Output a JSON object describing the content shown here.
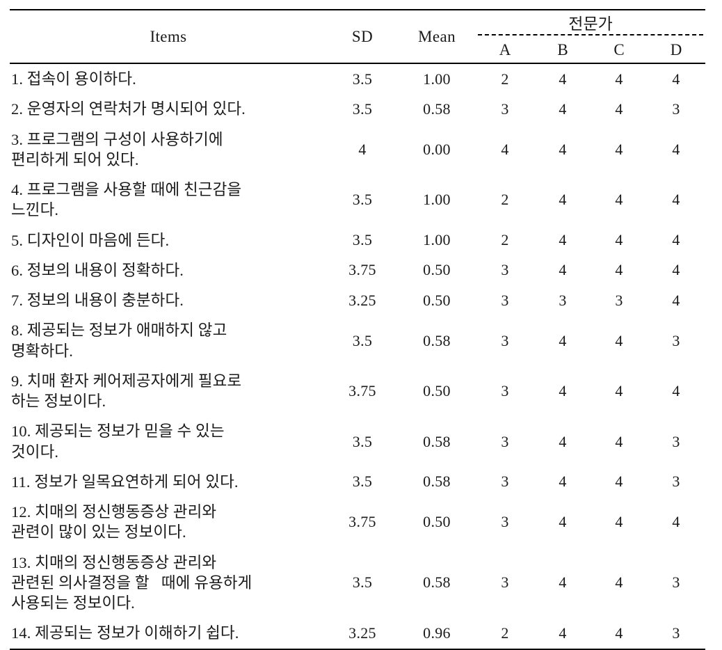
{
  "table": {
    "headers": {
      "items": "Items",
      "sd": "SD",
      "mean": "Mean",
      "group": "전문가",
      "a": "A",
      "b": "B",
      "c": "C",
      "d": "D"
    },
    "rows": [
      {
        "item": "1. 접속이 용이하다.",
        "sd": "3.5",
        "mean": "1.00",
        "a": "2",
        "b": "4",
        "c": "4",
        "d": "4"
      },
      {
        "item": "2. 운영자의 연락처가 명시되어 있다.",
        "sd": "3.5",
        "mean": "0.58",
        "a": "3",
        "b": "4",
        "c": "4",
        "d": "3"
      },
      {
        "item": "3. 프로그램의 구성이 사용하기에\n편리하게 되어 있다.",
        "sd": "4",
        "mean": "0.00",
        "a": "4",
        "b": "4",
        "c": "4",
        "d": "4"
      },
      {
        "item": "4. 프로그램을 사용할 때에 친근감을\n느낀다.",
        "sd": "3.5",
        "mean": "1.00",
        "a": "2",
        "b": "4",
        "c": "4",
        "d": "4"
      },
      {
        "item": "5. 디자인이 마음에 든다.",
        "sd": "3.5",
        "mean": "1.00",
        "a": "2",
        "b": "4",
        "c": "4",
        "d": "4"
      },
      {
        "item": "6. 정보의 내용이 정확하다.",
        "sd": "3.75",
        "mean": "0.50",
        "a": "3",
        "b": "4",
        "c": "4",
        "d": "4"
      },
      {
        "item": "7. 정보의 내용이 충분하다.",
        "sd": "3.25",
        "mean": "0.50",
        "a": "3",
        "b": "3",
        "c": "3",
        "d": "4"
      },
      {
        "item": "8. 제공되는 정보가 애매하지 않고\n명확하다.",
        "sd": "3.5",
        "mean": "0.58",
        "a": "3",
        "b": "4",
        "c": "4",
        "d": "3"
      },
      {
        "item": "9. 치매 환자 케어제공자에게 필요로\n하는 정보이다.",
        "sd": "3.75",
        "mean": "0.50",
        "a": "3",
        "b": "4",
        "c": "4",
        "d": "4"
      },
      {
        "item": "10. 제공되는 정보가 믿을 수 있는\n것이다.",
        "sd": "3.5",
        "mean": "0.58",
        "a": "3",
        "b": "4",
        "c": "4",
        "d": "3"
      },
      {
        "item": "11. 정보가 일목요연하게 되어 있다.",
        "sd": "3.5",
        "mean": "0.58",
        "a": "3",
        "b": "4",
        "c": "4",
        "d": "3"
      },
      {
        "item": "12. 치매의 정신행동증상 관리와\n관련이 많이 있는 정보이다.",
        "sd": "3.75",
        "mean": "0.50",
        "a": "3",
        "b": "4",
        "c": "4",
        "d": "4"
      },
      {
        "item": "13. 치매의 정신행동증상 관리와\n관련된 의사결정을 할   때에 유용하게\n사용되는 정보이다.",
        "sd": "3.5",
        "mean": "0.58",
        "a": "3",
        "b": "4",
        "c": "4",
        "d": "3"
      },
      {
        "item": "14. 제공되는 정보가 이해하기 쉽다.",
        "sd": "3.25",
        "mean": "0.96",
        "a": "2",
        "b": "4",
        "c": "4",
        "d": "3"
      }
    ]
  }
}
